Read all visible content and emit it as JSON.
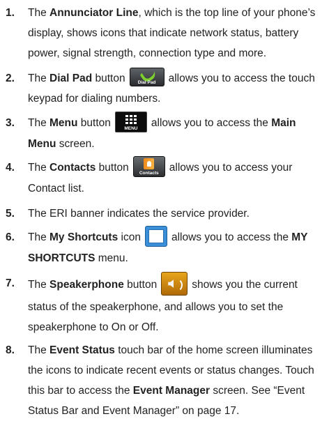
{
  "items": [
    {
      "number": "1.",
      "before": "The ",
      "bold": "Annunciator Line",
      "after": ", which is the top line of your phone’s display, shows icons that indicate network status, battery power, signal strength, connection type and more."
    },
    {
      "number": "2.",
      "before": "The ",
      "bold": "Dial Pad",
      "middle": " button",
      "icon": "dial-pad-icon",
      "icon_caption": "Dial Pad",
      "after": "allows you to access the touch keypad for dialing numbers."
    },
    {
      "number": "3.",
      "before": "The ",
      "bold": "Menu",
      "middle": " button",
      "icon": "menu-icon",
      "icon_caption": "MENU",
      "after": "allows you to access the ",
      "bold2": "Main Menu",
      "after2": " screen."
    },
    {
      "number": "4.",
      "before": "The ",
      "bold": "Contacts",
      "middle": " button",
      "icon": "contacts-icon",
      "icon_caption": "Contacts",
      "after": "allows you to access your Contact list."
    },
    {
      "number": "5.",
      "text": "The ERI banner indicates the service provider."
    },
    {
      "number": "6.",
      "before": "The ",
      "bold": "My Shortcuts",
      "middle": " icon",
      "icon": "my-shortcuts-icon",
      "after": "allows you to access the ",
      "bold2": "MY SHORTCUTS",
      "after2": " menu."
    },
    {
      "number": "7.",
      "before": "The ",
      "bold": "Speakerphone",
      "middle": " button",
      "icon": "speakerphone-icon",
      "after": "shows you the current status of the speakerphone, and allows you to set the speakerphone to On or Off."
    },
    {
      "number": "8.",
      "before": "The ",
      "bold": "Event Status",
      "after": " touch bar of the home screen illuminates the icons to indicate recent events or status changes. Touch this bar to access the ",
      "bold2": "Event Manager",
      "after2": " screen. See “Event Status Bar and Event Manager” on page 17."
    }
  ]
}
